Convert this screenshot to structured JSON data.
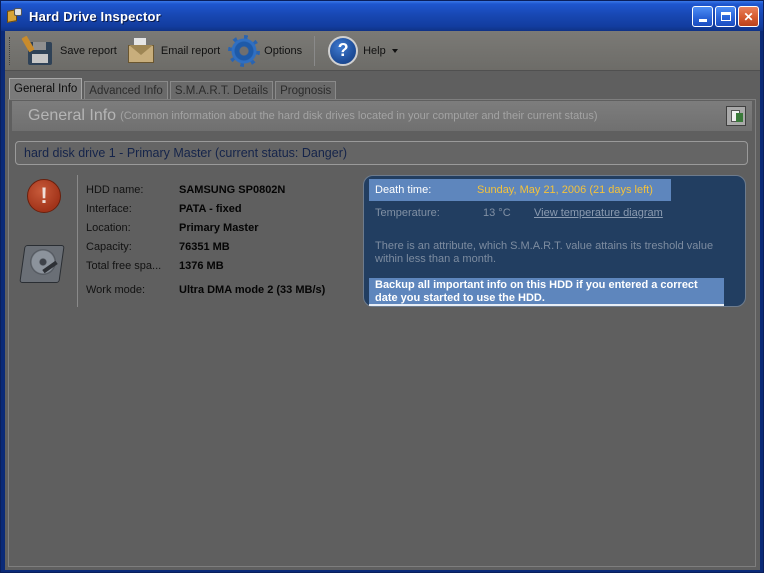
{
  "window": {
    "title": "Hard Drive Inspector"
  },
  "toolbar": {
    "save_report": "Save report",
    "email_report": "Email report",
    "options": "Options",
    "help": "Help"
  },
  "tabs": [
    "General Info",
    "Advanced Info",
    "S.M.A.R.T. Details",
    "Prognosis"
  ],
  "section": {
    "title": "General Info",
    "description": "(Common information about the hard disk drives located in your computer and their current status)"
  },
  "drive": {
    "header": "hard disk drive 1 - Primary Master (current status: Danger)",
    "info": [
      {
        "label": "HDD name:",
        "value": "SAMSUNG SP0802N"
      },
      {
        "label": "Interface:",
        "value": "PATA - fixed"
      },
      {
        "label": "Location:",
        "value": "Primary Master"
      },
      {
        "label": "Capacity:",
        "value": "76351 MB"
      },
      {
        "label": "Total free spa...",
        "value": "1376 MB"
      },
      {
        "label": "Work mode:",
        "value": "Ultra DMA mode 2 (33 MB/s)"
      }
    ]
  },
  "status": {
    "death_label": "Death time:",
    "death_value": "Sunday, May 21, 2006  (21 days left)",
    "temp_label": "Temperature:",
    "temp_value": "13 °C",
    "temp_link": "View temperature diagram",
    "attribute_text": "There is an attribute, which S.M.A.R.T. value attains its treshold value within less than a month.",
    "backup_text": "Backup all important info on this HDD if you entered a correct date you started to use the HDD."
  },
  "colors": {
    "death_value": "#f4c23b",
    "status_box": "#223e61",
    "highlight": "#5e86bd",
    "title_bar": "#1848b4"
  }
}
